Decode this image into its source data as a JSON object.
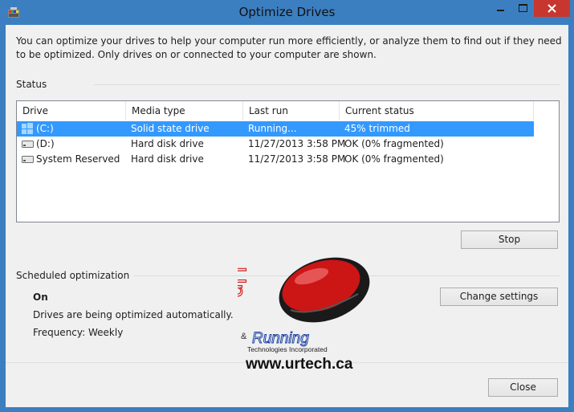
{
  "window": {
    "title": "Optimize Drives"
  },
  "intro": "You can optimize your drives to help your computer run more efficiently, or analyze them to find out if they need to be optimized. Only drives on or connected to your computer are shown.",
  "status": {
    "label": "Status",
    "columns": [
      "Drive",
      "Media type",
      "Last run",
      "Current status"
    ],
    "rows": [
      {
        "drive": "(C:)",
        "media": "Solid state drive",
        "last": "Running...",
        "status": "45% trimmed",
        "selected": true
      },
      {
        "drive": "(D:)",
        "media": "Hard disk drive",
        "last": "11/27/2013 3:58 PM",
        "status": "OK (0% fragmented)",
        "selected": false
      },
      {
        "drive": "System Reserved",
        "media": "Hard disk drive",
        "last": "11/27/2013 3:58 PM",
        "status": "OK (0% fragmented)",
        "selected": false
      }
    ],
    "stop_label": "Stop"
  },
  "scheduled": {
    "label": "Scheduled optimization",
    "state": "On",
    "description": "Drives are being optimized automatically.",
    "frequency": "Frequency: Weekly",
    "change_label": "Change settings"
  },
  "footer": {
    "close_label": "Close"
  },
  "watermark": {
    "brand_up": "Up",
    "brand_amp": "&",
    "brand_running": "Running",
    "brand_sub": "Technologies Incorporated",
    "brand_url": "www.urtech.ca"
  }
}
